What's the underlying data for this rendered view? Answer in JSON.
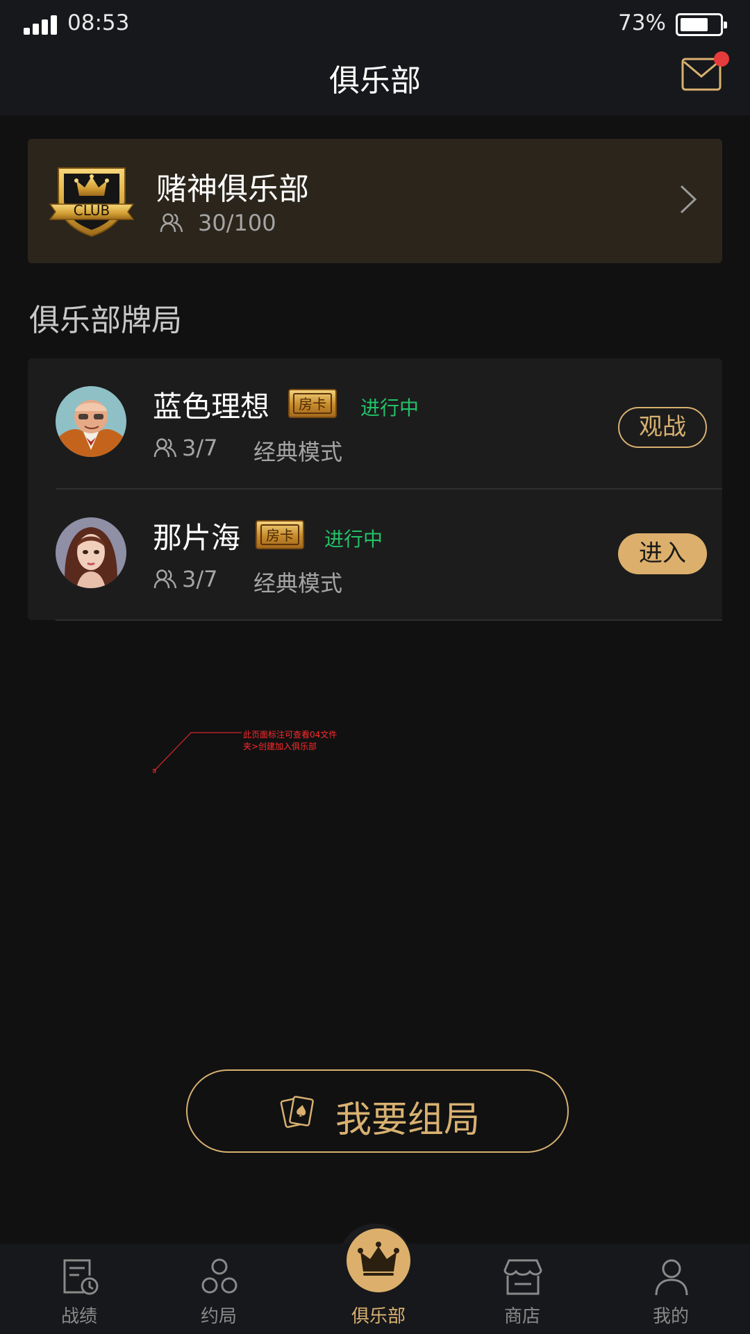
{
  "status_bar": {
    "time": "08:53",
    "battery_percent": "73%",
    "battery_level": 0.73,
    "signal_bars": 4
  },
  "header": {
    "title": "俱乐部",
    "mail_icon": "mail-icon",
    "has_unread": true
  },
  "club": {
    "name": "赌神俱乐部",
    "members": "30/100",
    "badge_text": "CLUB"
  },
  "section": {
    "title": "俱乐部牌局"
  },
  "games": [
    {
      "name": "蓝色理想",
      "tag": "房卡",
      "status": "进行中",
      "players": "3/7",
      "mode": "经典模式",
      "action": "观战"
    },
    {
      "name": "那片海",
      "tag": "房卡",
      "status": "进行中",
      "players": "3/7",
      "mode": "经典模式",
      "action": "进入"
    }
  ],
  "annotation": {
    "text": "此页面标注可查看04文件夹>创建加入俱乐部"
  },
  "create_button": {
    "label": "我要组局"
  },
  "tabs": [
    {
      "label": "战绩",
      "icon": "record-icon"
    },
    {
      "label": "约局",
      "icon": "group-icon"
    },
    {
      "label": "俱乐部",
      "icon": "crown-icon",
      "active": true
    },
    {
      "label": "商店",
      "icon": "shop-icon"
    },
    {
      "label": "我的",
      "icon": "profile-icon"
    }
  ],
  "colors": {
    "accent": "#dcb06c",
    "status_green": "#22c367",
    "background": "#111112",
    "notice_red": "#e53b3b"
  }
}
